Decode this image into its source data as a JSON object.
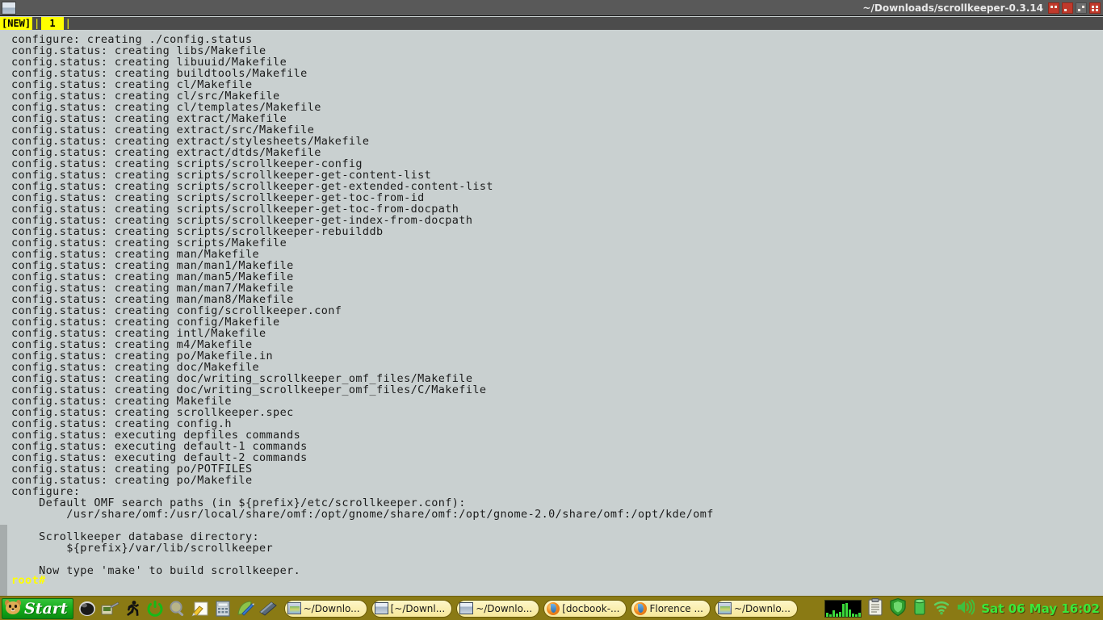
{
  "window": {
    "title": "~/Downloads/scrollkeeper-0.3.14",
    "menu_icon": "window-menu-icon",
    "buttons": [
      {
        "name": "shade-button",
        "state": "active"
      },
      {
        "name": "minimize-button",
        "state": "active"
      },
      {
        "name": "maximize-button",
        "state": "inactive"
      },
      {
        "name": "close-button",
        "state": "active"
      }
    ]
  },
  "tabbar": {
    "new_tab_label": "[NEW]",
    "separator": "|",
    "tabs": [
      {
        "label": "1",
        "active": true
      }
    ]
  },
  "terminal": {
    "prompt": "root#",
    "prompt_color": "#ffff00",
    "background_color": "#c9d0d0",
    "foreground_color": "#1b1b1b",
    "scrollbar_position": "left",
    "lines": [
      "configure: creating ./config.status",
      "config.status: creating libs/Makefile",
      "config.status: creating libuuid/Makefile",
      "config.status: creating buildtools/Makefile",
      "config.status: creating cl/Makefile",
      "config.status: creating cl/src/Makefile",
      "config.status: creating cl/templates/Makefile",
      "config.status: creating extract/Makefile",
      "config.status: creating extract/src/Makefile",
      "config.status: creating extract/stylesheets/Makefile",
      "config.status: creating extract/dtds/Makefile",
      "config.status: creating scripts/scrollkeeper-config",
      "config.status: creating scripts/scrollkeeper-get-content-list",
      "config.status: creating scripts/scrollkeeper-get-extended-content-list",
      "config.status: creating scripts/scrollkeeper-get-toc-from-id",
      "config.status: creating scripts/scrollkeeper-get-toc-from-docpath",
      "config.status: creating scripts/scrollkeeper-get-index-from-docpath",
      "config.status: creating scripts/scrollkeeper-rebuilddb",
      "config.status: creating scripts/Makefile",
      "config.status: creating man/Makefile",
      "config.status: creating man/man1/Makefile",
      "config.status: creating man/man5/Makefile",
      "config.status: creating man/man7/Makefile",
      "config.status: creating man/man8/Makefile",
      "config.status: creating config/scrollkeeper.conf",
      "config.status: creating config/Makefile",
      "config.status: creating intl/Makefile",
      "config.status: creating m4/Makefile",
      "config.status: creating po/Makefile.in",
      "config.status: creating doc/Makefile",
      "config.status: creating doc/writing_scrollkeeper_omf_files/Makefile",
      "config.status: creating doc/writing_scrollkeeper_omf_files/C/Makefile",
      "config.status: creating Makefile",
      "config.status: creating scrollkeeper.spec",
      "config.status: creating config.h",
      "config.status: executing depfiles commands",
      "config.status: executing default-1 commands",
      "config.status: executing default-2 commands",
      "config.status: creating po/POTFILES",
      "config.status: creating po/Makefile",
      "configure:",
      "    Default OMF search paths (in ${prefix}/etc/scrollkeeper.conf):",
      "        /usr/share/omf:/usr/local/share/omf:/opt/gnome/share/omf:/opt/gnome-2.0/share/omf:/opt/kde/omf",
      "",
      "    Scrollkeeper database directory:",
      "        ${prefix}/var/lib/scrollkeeper",
      "",
      "    Now type 'make' to build scrollkeeper."
    ]
  },
  "taskbar": {
    "start_label": "Start",
    "start_icon": "dog-face-icon",
    "launchers": [
      {
        "name": "mouse-menu-icon"
      },
      {
        "name": "terminal-tools-icon"
      },
      {
        "name": "running-man-icon"
      },
      {
        "name": "power-icon"
      },
      {
        "name": "magnifier-icon"
      },
      {
        "name": "notepad-icon"
      },
      {
        "name": "calculator-icon"
      },
      {
        "name": "text-editor-icon"
      },
      {
        "name": "files-icon"
      }
    ],
    "windows": [
      {
        "label": "~/Downlo...",
        "icon": "folder-icon"
      },
      {
        "label": "[~/Downl...",
        "icon": "terminal-icon"
      },
      {
        "label": "~/Downlo...",
        "icon": "terminal-icon"
      },
      {
        "label": "[docbook-...",
        "icon": "firefox-icon"
      },
      {
        "label": "Florence ...",
        "icon": "firefox-icon"
      },
      {
        "label": "~/Downlo...",
        "icon": "folder-icon"
      }
    ],
    "tray": [
      {
        "name": "system-monitor-graph"
      },
      {
        "name": "clipboard-icon"
      },
      {
        "name": "shield-icon"
      },
      {
        "name": "battery-icon"
      },
      {
        "name": "wifi-icon"
      },
      {
        "name": "volume-icon"
      }
    ],
    "clock": "Sat 06 May 16:02",
    "clock_color": "#3ae83a",
    "background_color": "#8a7a14"
  }
}
